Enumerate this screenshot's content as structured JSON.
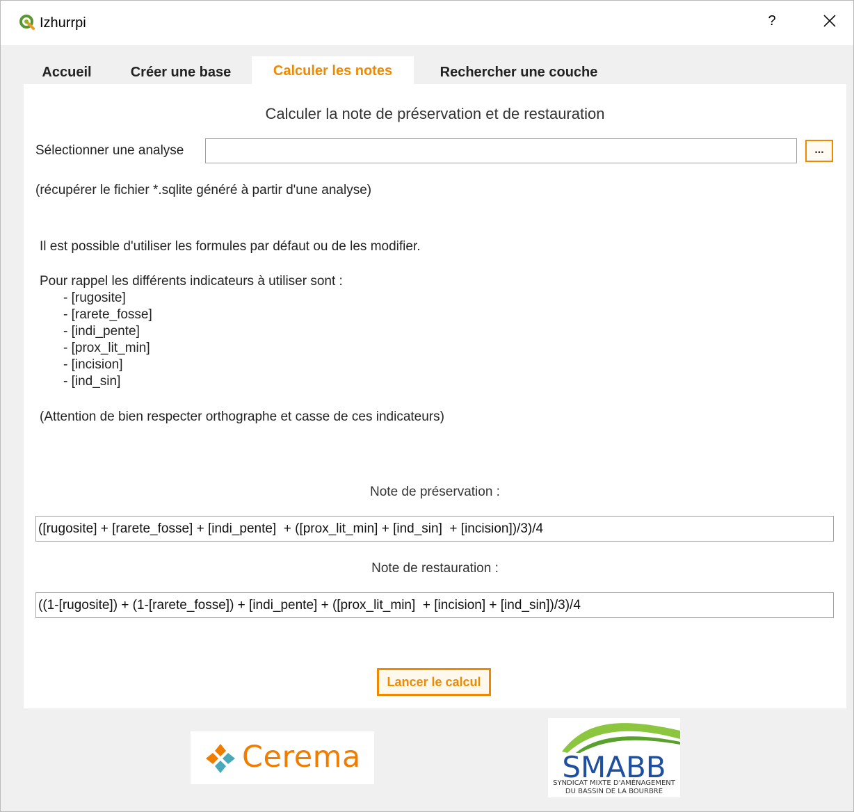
{
  "window": {
    "title": "Izhurrpi",
    "help_label": "?",
    "close_icon": "close-icon"
  },
  "tabs": [
    {
      "label": "Accueil",
      "active": false
    },
    {
      "label": "Créer une base",
      "active": false
    },
    {
      "label": "Calculer les notes",
      "active": true
    },
    {
      "label": "Rechercher une couche",
      "active": false
    }
  ],
  "panel": {
    "heading": "Calculer la note de préservation et de restauration",
    "select_label": "Sélectionner une  analyse",
    "file_value": "",
    "browse_label": "...",
    "hint": "(récupérer le fichier *.sqlite généré à partir d'une analyse)",
    "info_line1": "Il est possible d'utiliser les formules par défaut ou de les modifier.",
    "info_line2": "Pour rappel les différents indicateurs à utiliser sont :",
    "indicators": [
      "- [rugosite]",
      "- [rarete_fosse]",
      "- [indi_pente]",
      "- [prox_lit_min]",
      "- [incision]",
      "- [ind_sin]"
    ],
    "warning": "(Attention de bien respecter orthographe et casse de ces indicateurs)",
    "preservation_label": "Note de préservation :",
    "preservation_formula": "([rugosite] + [rarete_fosse] + [indi_pente]  + ([prox_lit_min] + [ind_sin]  + [incision])/3)/4",
    "restoration_label": "Note de restauration :",
    "restoration_formula": "((1-[rugosite]) + (1-[rarete_fosse]) + [indi_pente] + ([prox_lit_min]  + [incision] + [ind_sin])/3)/4",
    "run_label": "Lancer le calcul"
  },
  "logos": {
    "cerema": "Cerema",
    "smabb": "SMABB",
    "smabb_sub1": "SYNDICAT MIXTE D'AMÉNAGEMENT",
    "smabb_sub2": "DU BASSIN DE LA BOURBRE"
  },
  "colors": {
    "accent": "#ef8a00",
    "cerema": "#ef7d00",
    "smabb_blue": "#1f4f9e",
    "smabb_green": "#8cc63f"
  }
}
